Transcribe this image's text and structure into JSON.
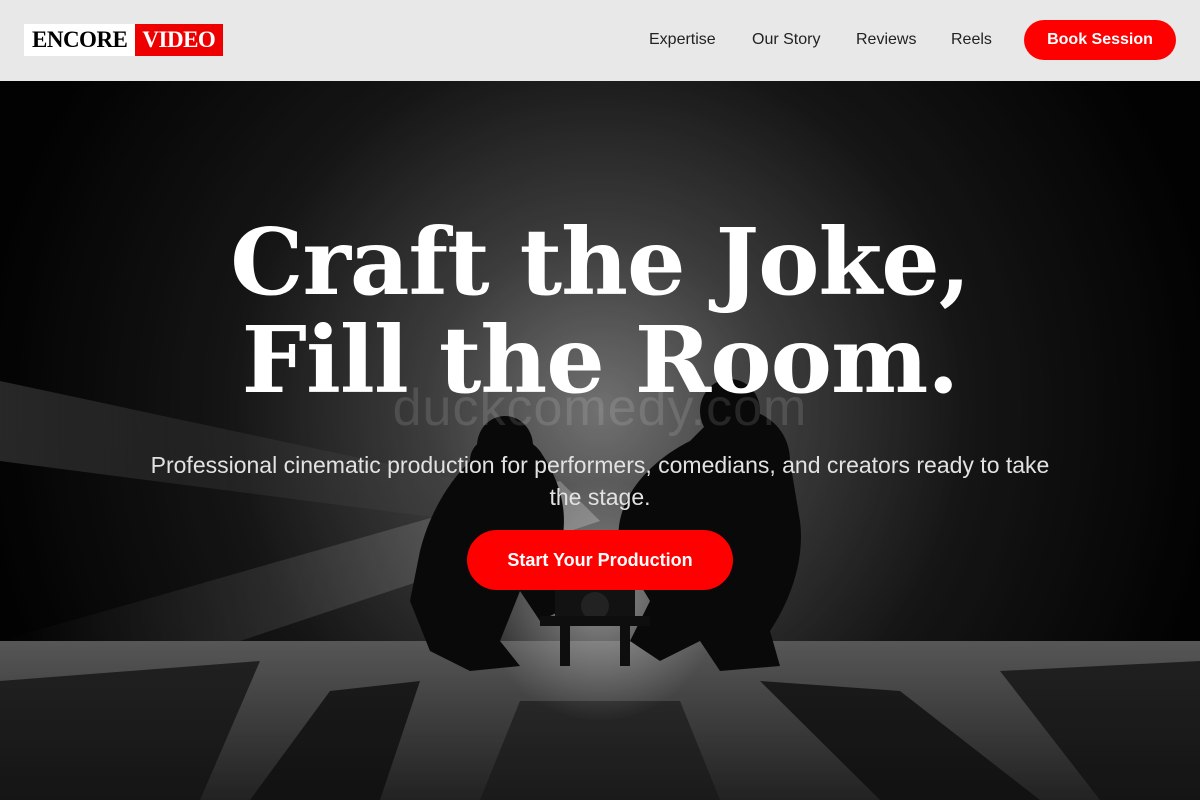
{
  "brand": {
    "part1": "ENCORE",
    "part2": "VIDEO"
  },
  "nav": {
    "links": [
      "Expertise",
      "Our Story",
      "Reviews",
      "Reels"
    ],
    "cta_label": "Book Session"
  },
  "hero": {
    "headline_line1": "Craft the Joke,",
    "headline_line2": "Fill the Room.",
    "subtitle": "Professional cinematic production for performers, comedians, and creators ready to take the stage.",
    "cta_label": "Start Your Production",
    "watermark": "duckcomedy.com",
    "background": "black-and-white photo of two camera operators crouching with a camera rig under stage light"
  },
  "colors": {
    "accent": "#ff0000",
    "nav_bg": "#e8e8e8",
    "hero_bg": "#000000"
  }
}
